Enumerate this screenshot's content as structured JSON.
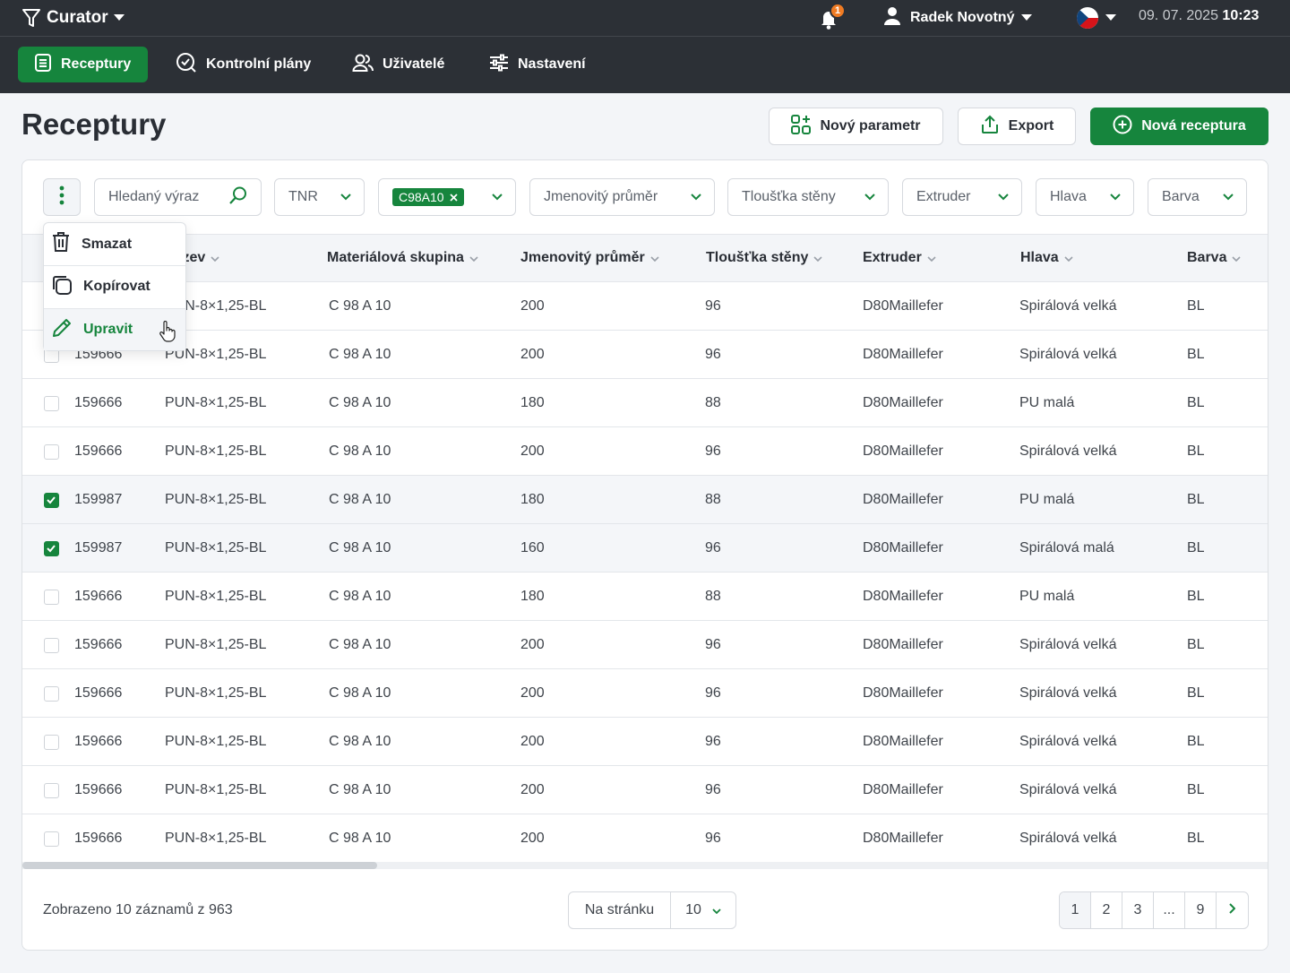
{
  "app": {
    "name": "Curator"
  },
  "topbar": {
    "notification_count": "1",
    "user_name": "Radek Novotný",
    "date": "09. 07. 2025",
    "time": "10:23"
  },
  "nav": [
    {
      "label": "Receptury",
      "icon": "list-icon",
      "active": true
    },
    {
      "label": "Kontrolní plány",
      "icon": "check-circle-icon",
      "active": false
    },
    {
      "label": "Uživatelé",
      "icon": "users-icon",
      "active": false
    },
    {
      "label": "Nastavení",
      "icon": "sliders-icon",
      "active": false
    }
  ],
  "page": {
    "title": "Receptury",
    "buttons": {
      "new_param": "Nový parametr",
      "export": "Export",
      "new_recipe": "Nová receptura"
    }
  },
  "filters": {
    "search_placeholder": "Hledaný výraz",
    "tnr": "TNR",
    "chip": "C98A10",
    "diameter": "Jmenovitý průměr",
    "wall": "Tloušťka stěny",
    "extruder": "Extruder",
    "head": "Hlava",
    "color": "Barva"
  },
  "table": {
    "columns": [
      "Název",
      "Materiálová skupina",
      "Jmenovitý průměr",
      "Tloušťka stěny",
      "Extruder",
      "Hlava",
      "Barva"
    ],
    "rows": [
      {
        "checked": false,
        "id": "159666",
        "name": "PUN-8×1,25-BL",
        "group": "C 98 A 10",
        "diameter": "200",
        "wall": "96",
        "extruder": "D80Maillefer",
        "head": "Spirálová velká",
        "color": "BL"
      },
      {
        "checked": false,
        "id": "159666",
        "name": "PUN-8×1,25-BL",
        "group": "C 98 A 10",
        "diameter": "200",
        "wall": "96",
        "extruder": "D80Maillefer",
        "head": "Spirálová velká",
        "color": "BL"
      },
      {
        "checked": false,
        "id": "159666",
        "name": "PUN-8×1,25-BL",
        "group": "C 98 A 10",
        "diameter": "180",
        "wall": "88",
        "extruder": "D80Maillefer",
        "head": "PU malá",
        "color": "BL"
      },
      {
        "checked": false,
        "id": "159666",
        "name": "PUN-8×1,25-BL",
        "group": "C 98 A 10",
        "diameter": "200",
        "wall": "96",
        "extruder": "D80Maillefer",
        "head": "Spirálová velká",
        "color": "BL"
      },
      {
        "checked": true,
        "id": "159987",
        "name": "PUN-8×1,25-BL",
        "group": "C 98 A 10",
        "diameter": "180",
        "wall": "88",
        "extruder": "D80Maillefer",
        "head": "PU malá",
        "color": "BL"
      },
      {
        "checked": true,
        "id": "159987",
        "name": "PUN-8×1,25-BL",
        "group": "C 98 A 10",
        "diameter": "160",
        "wall": "96",
        "extruder": "D80Maillefer",
        "head": "Spirálová malá",
        "color": "BL"
      },
      {
        "checked": false,
        "id": "159666",
        "name": "PUN-8×1,25-BL",
        "group": "C 98 A 10",
        "diameter": "180",
        "wall": "88",
        "extruder": "D80Maillefer",
        "head": "PU malá",
        "color": "BL"
      },
      {
        "checked": false,
        "id": "159666",
        "name": "PUN-8×1,25-BL",
        "group": "C 98 A 10",
        "diameter": "200",
        "wall": "96",
        "extruder": "D80Maillefer",
        "head": "Spirálová velká",
        "color": "BL"
      },
      {
        "checked": false,
        "id": "159666",
        "name": "PUN-8×1,25-BL",
        "group": "C 98 A 10",
        "diameter": "200",
        "wall": "96",
        "extruder": "D80Maillefer",
        "head": "Spirálová velká",
        "color": "BL"
      },
      {
        "checked": false,
        "id": "159666",
        "name": "PUN-8×1,25-BL",
        "group": "C 98 A 10",
        "diameter": "200",
        "wall": "96",
        "extruder": "D80Maillefer",
        "head": "Spirálová velká",
        "color": "BL"
      },
      {
        "checked": false,
        "id": "159666",
        "name": "PUN-8×1,25-BL",
        "group": "C 98 A 10",
        "diameter": "200",
        "wall": "96",
        "extruder": "D80Maillefer",
        "head": "Spirálová velká",
        "color": "BL"
      },
      {
        "checked": false,
        "id": "159666",
        "name": "PUN-8×1,25-BL",
        "group": "C 98 A 10",
        "diameter": "200",
        "wall": "96",
        "extruder": "D80Maillefer",
        "head": "Spirálová velká",
        "color": "BL"
      }
    ]
  },
  "row_menu": {
    "delete": "Smazat",
    "copy": "Kopírovat",
    "edit": "Upravit"
  },
  "footer": {
    "summary": "Zobrazeno 10 záznamů z 963",
    "per_page_label": "Na stránku",
    "per_page_value": "10",
    "pages": [
      "1",
      "2",
      "3",
      "...",
      "9"
    ]
  },
  "colors": {
    "accent": "#16853d",
    "topbar": "#2c3036",
    "badge": "#f07b23"
  }
}
